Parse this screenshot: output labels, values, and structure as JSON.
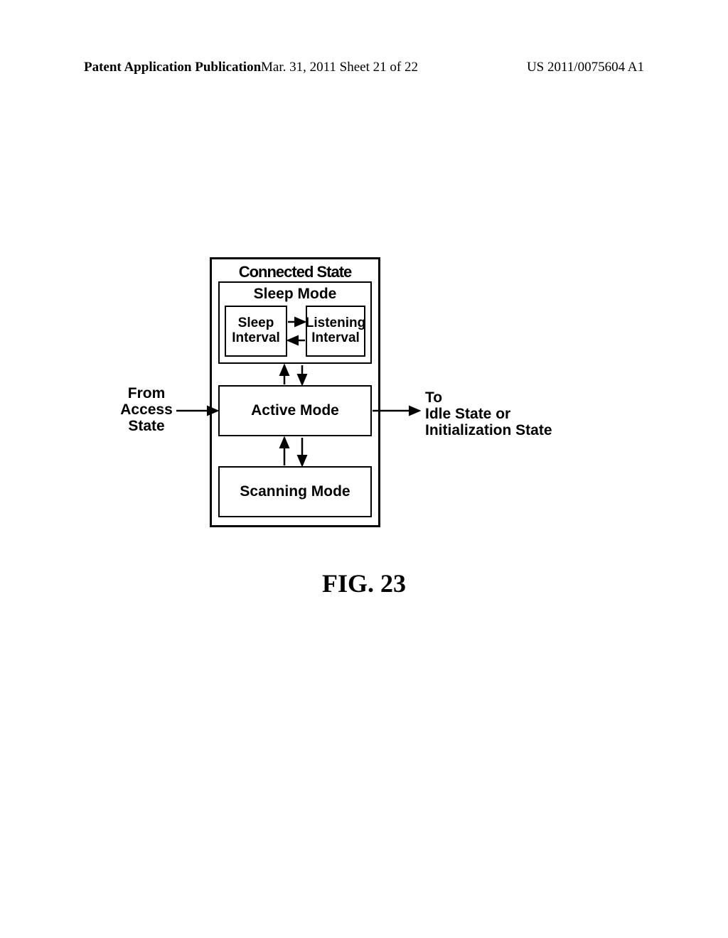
{
  "header": {
    "left": "Patent Application Publication",
    "center": "Mar. 31, 2011  Sheet 21 of 22",
    "right": "US 2011/0075604 A1"
  },
  "diagram": {
    "outer_title": "Connected State",
    "sleep_mode_title": "Sleep Mode",
    "sleep_interval": "Sleep\nInterval",
    "listening_interval": "Listening\nInterval",
    "active_mode": "Active Mode",
    "scanning_mode": "Scanning Mode",
    "from_access": "From\nAccess\nState",
    "to_idle": "To\nIdle State or\nInitialization State"
  },
  "figure_label": "FIG. 23"
}
